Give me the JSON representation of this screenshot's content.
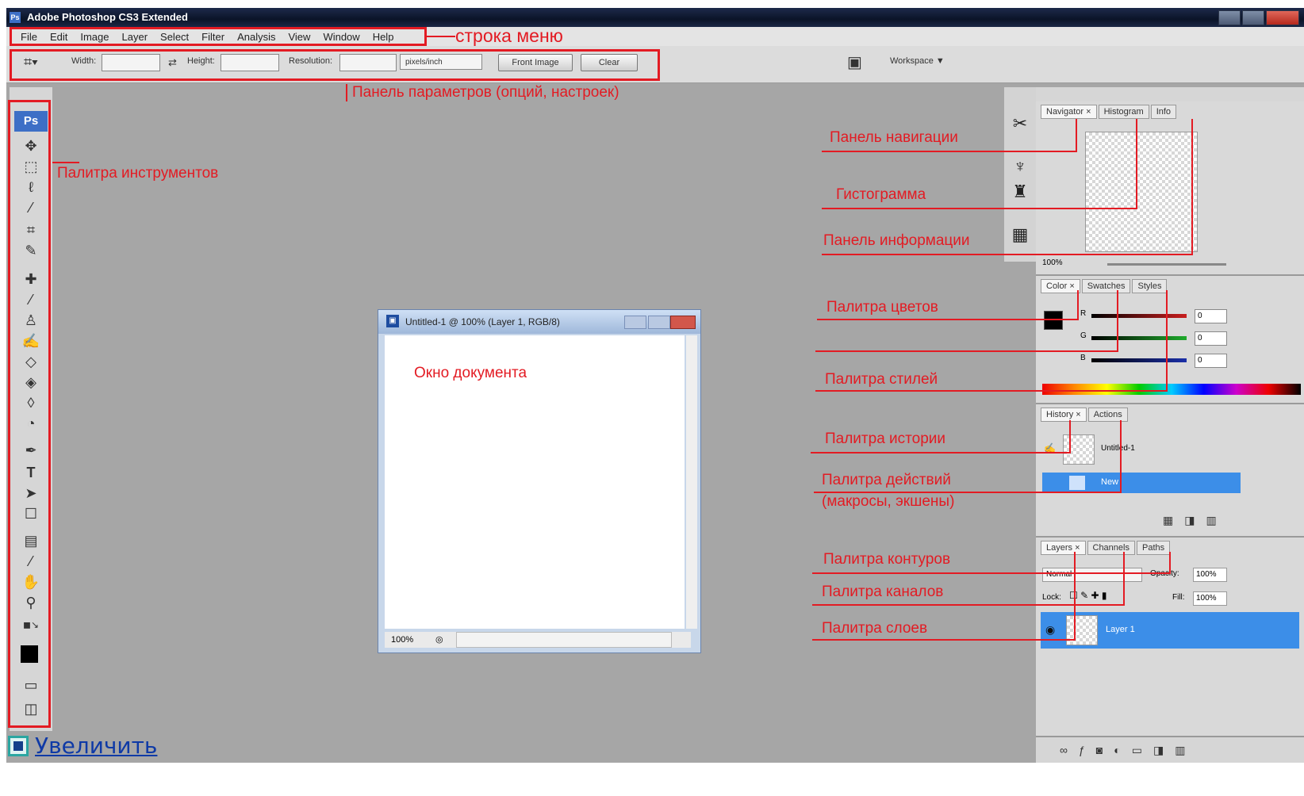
{
  "window": {
    "title": "Adobe Photoshop CS3 Extended",
    "app_badge": "Ps"
  },
  "menu": {
    "items": [
      "File",
      "Edit",
      "Image",
      "Layer",
      "Select",
      "Filter",
      "Analysis",
      "View",
      "Window",
      "Help"
    ]
  },
  "options_bar": {
    "width_label": "Width:",
    "height_label": "Height:",
    "resolution_label": "Resolution:",
    "units_value": "pixels/inch",
    "front_image_button": "Front Image",
    "clear_button": "Clear",
    "workspace_label": "Workspace ▼"
  },
  "annotations": {
    "menu_bar": "строка меню",
    "options_panel": "Панель параметров (опций, настроек)",
    "tools_palette": "Палитра инструментов",
    "document_window": "Окно документа",
    "navigator": "Панель навигации",
    "histogram": "Гистограмма",
    "info": "Панель информации",
    "color": "Палитра цветов",
    "styles": "Палитра стилей",
    "history": "Палитра истории",
    "actions_1": "Палитра действий",
    "actions_2": "(макросы, экшены)",
    "paths": "Палитра контуров",
    "channels": "Палитра каналов",
    "layers": "Палитра слоев"
  },
  "document": {
    "title": "Untitled-1 @ 100% (Layer 1, RGB/8)",
    "zoom": "100%"
  },
  "panels": {
    "navigator_tabs": [
      "Navigator ×",
      "Histogram",
      "Info"
    ],
    "navigator_zoom": "100%",
    "color_tabs": [
      "Color ×",
      "Swatches",
      "Styles"
    ],
    "color_channels": [
      {
        "name": "R",
        "value": "0",
        "color": "#c81e1e"
      },
      {
        "name": "G",
        "value": "0",
        "color": "#1faa2c"
      },
      {
        "name": "B",
        "value": "0",
        "color": "#1b2fa8"
      }
    ],
    "history_tabs": [
      "History ×",
      "Actions"
    ],
    "history_snapshot": "Untitled-1",
    "history_state": "New",
    "layers_tabs": [
      "Layers ×",
      "Channels",
      "Paths"
    ],
    "blend_mode": "Normal",
    "opacity_label": "Opacity:",
    "opacity_value": "100%",
    "lock_label": "Lock:",
    "fill_label": "Fill:",
    "fill_value": "100%",
    "layer_name": "Layer 1"
  },
  "tools": [
    "move-icon",
    "marquee-icon",
    "lasso-icon",
    "magic-wand-icon",
    "crop-icon",
    "slice-icon",
    "healing-icon",
    "brush-icon",
    "stamp-icon",
    "history-brush-icon",
    "eraser-icon",
    "bucket-icon",
    "blur-icon",
    "dodge-icon",
    "pen-icon",
    "type-icon",
    "path-select-icon",
    "shape-icon",
    "notes-icon",
    "eyedropper-icon",
    "hand-icon",
    "zoom-icon"
  ],
  "footer": {
    "link_text": "Увеличить"
  },
  "colors": {
    "annotation": "#e31b23",
    "accent": "#3c8ee8"
  }
}
